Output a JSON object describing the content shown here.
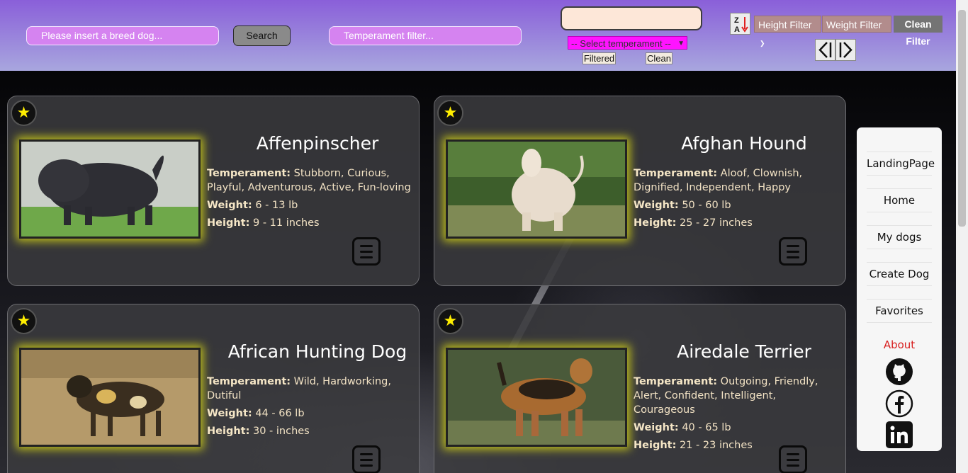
{
  "header": {
    "breed_placeholder": "Please insert a breed dog...",
    "search_label": "Search",
    "temperament_placeholder": "Temperament filter...",
    "temperament_select": "-- Select temperament --",
    "filtered_label": "Filtered",
    "clean_label": "Clean",
    "sort_icon": "sort-za-icon",
    "height_filter_label": "Height Filter",
    "weight_filter_label": "Weight Filter",
    "clean_filter_label": "Clean Filter",
    "prev_icon": "chevron-left-icon",
    "next_icon": "chevron-right-icon"
  },
  "cards": [
    {
      "name": "Affenpinscher",
      "temperament_label": "Temperament:",
      "temperament": "Stubborn, Curious, Playful, Adventurous, Active, Fun-loving",
      "weight_label": "Weight:",
      "weight": "6 - 13 lb",
      "height_label": "Height:",
      "height": "9 - 11 inches"
    },
    {
      "name": "Afghan Hound",
      "temperament_label": "Temperament:",
      "temperament": "Aloof, Clownish, Dignified, Independent, Happy",
      "weight_label": "Weight:",
      "weight": "50 - 60 lb",
      "height_label": "Height:",
      "height": "25 - 27 inches"
    },
    {
      "name": "African Hunting Dog",
      "temperament_label": "Temperament:",
      "temperament": "Wild, Hardworking, Dutiful",
      "weight_label": "Weight:",
      "weight": "44 - 66 lb",
      "height_label": "Height:",
      "height": "30 - inches"
    },
    {
      "name": "Airedale Terrier",
      "temperament_label": "Temperament:",
      "temperament": "Outgoing, Friendly, Alert, Confident, Intelligent, Courageous",
      "weight_label": "Weight:",
      "weight": "40 - 65 lb",
      "height_label": "Height:",
      "height": "21 - 23 inches"
    }
  ],
  "nav": {
    "items": [
      "LandingPage",
      "Home",
      "My dogs",
      "Create Dog",
      "Favorites"
    ],
    "about": "About",
    "social_icons": [
      "github-icon",
      "facebook-icon",
      "linkedin-icon"
    ]
  },
  "colors": {
    "header_gradient_top": "#8a5fd9",
    "input_fill": "#d583f0",
    "select_fill": "#ff14ff",
    "filter_button": "#b28c8c",
    "star": "#ffee00",
    "image_glow": "#e6e614",
    "about_text": "#d81f1f"
  }
}
